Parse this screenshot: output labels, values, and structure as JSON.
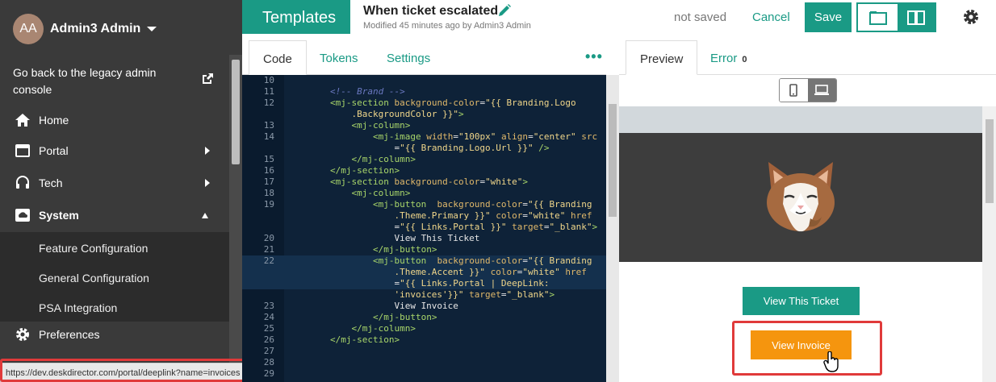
{
  "sidebar": {
    "user": {
      "initials": "AA",
      "name": "Admin3 Admin"
    },
    "legacy_link": "Go back to the legacy admin console",
    "nav": [
      {
        "label": "Home",
        "icon": "home-icon"
      },
      {
        "label": "Portal",
        "icon": "portal-icon"
      },
      {
        "label": "Tech",
        "icon": "headset-icon"
      },
      {
        "label": "System",
        "icon": "cloud-icon"
      },
      {
        "label": "Preferences",
        "icon": "gear-icon"
      }
    ],
    "system_sub": [
      "Feature Configuration",
      "General Configuration",
      "PSA Integration"
    ],
    "status_url": "https://dev.deskdirector.com/portal/deeplink?name=invoices"
  },
  "header": {
    "section": "Templates",
    "title": "When ticket escalated",
    "modified": "Modified 45 minutes ago by Admin3 Admin",
    "status": "not saved",
    "cancel": "Cancel",
    "save": "Save"
  },
  "editor_tabs": [
    "Code",
    "Tokens",
    "Settings"
  ],
  "editor_more": "•••",
  "code_lines": [
    {
      "n": "10",
      "html": ""
    },
    {
      "n": "11",
      "html": "        <span class=\"cmt\">&lt;!-- Brand --&gt;</span>"
    },
    {
      "n": "12",
      "html": "        <span class=\"tag\">&lt;mj-section</span> <span class=\"att\">background-color</span>=<span class=\"str\">\"{{ Branding.Logo</span>"
    },
    {
      "n": "",
      "html": "            <span class=\"str\">.BackgroundColor }}\"</span><span class=\"tag\">&gt;</span>"
    },
    {
      "n": "13",
      "html": "            <span class=\"tag\">&lt;mj-column&gt;</span>"
    },
    {
      "n": "14",
      "html": "                <span class=\"tag\">&lt;mj-image</span> <span class=\"att\">width</span>=<span class=\"str\">\"100px\"</span> <span class=\"att\">align</span>=<span class=\"str\">\"center\"</span> <span class=\"att\">src</span>"
    },
    {
      "n": "",
      "html": "                    =<span class=\"str\">\"{{ Branding.Logo.Url }}\"</span> <span class=\"tag\">/&gt;</span>"
    },
    {
      "n": "15",
      "html": "            <span class=\"tag\">&lt;/mj-column&gt;</span>"
    },
    {
      "n": "16",
      "html": "        <span class=\"tag\">&lt;/mj-section&gt;</span>"
    },
    {
      "n": "17",
      "html": "        <span class=\"tag\">&lt;mj-section</span> <span class=\"att\">background-color</span>=<span class=\"str\">\"white\"</span><span class=\"tag\">&gt;</span>"
    },
    {
      "n": "18",
      "html": "            <span class=\"tag\">&lt;mj-column&gt;</span>"
    },
    {
      "n": "19",
      "html": "                <span class=\"tag\">&lt;mj-button</span>  <span class=\"att\">background-color</span>=<span class=\"str\">\"{{ Branding</span>"
    },
    {
      "n": "",
      "html": "                    <span class=\"str\">.Theme.Primary }}\"</span> <span class=\"att\">color</span>=<span class=\"str\">\"white\"</span> <span class=\"att\">href</span>"
    },
    {
      "n": "",
      "html": "                    =<span class=\"str\">\"{{ Links.Portal }}\"</span> <span class=\"att\">target</span>=<span class=\"str\">\"_blank\"</span><span class=\"tag\">&gt;</span>"
    },
    {
      "n": "20",
      "html": "                    View This Ticket"
    },
    {
      "n": "21",
      "html": "                <span class=\"tag\">&lt;/mj-button&gt;</span>"
    },
    {
      "n": "22",
      "html": "                <span class=\"tag\">&lt;mj-button</span>  <span class=\"att\">background-color</span>=<span class=\"str\">\"{{ Branding</span>"
    },
    {
      "n": "",
      "html": "                    <span class=\"str\">.Theme.Accent }}\"</span> <span class=\"att\">color</span>=<span class=\"str\">\"white\"</span> <span class=\"att\">href</span>"
    },
    {
      "n": "",
      "html": "                    =<span class=\"str\">\"{{ Links.Portal | DeepLink:</span>"
    },
    {
      "n": "",
      "html": "                    <span class=\"str\">'invoices'}}\"</span> <span class=\"att\">target</span>=<span class=\"str\">\"_blank\"</span><span class=\"tag\">&gt;</span>"
    },
    {
      "n": "23",
      "html": "                    View Invoice"
    },
    {
      "n": "24",
      "html": "                <span class=\"tag\">&lt;/mj-button&gt;</span>"
    },
    {
      "n": "25",
      "html": "            <span class=\"tag\">&lt;/mj-column&gt;</span>"
    },
    {
      "n": "26",
      "html": "        <span class=\"tag\">&lt;/mj-section&gt;</span>"
    },
    {
      "n": "27",
      "html": ""
    },
    {
      "n": "28",
      "html": ""
    },
    {
      "n": "29",
      "html": ""
    }
  ],
  "preview_tabs": {
    "preview": "Preview",
    "error": "Error",
    "error_count": "0"
  },
  "preview": {
    "primary_button": "View This Ticket",
    "accent_button": "View Invoice"
  },
  "colors": {
    "brand": "#1a9a85",
    "accent": "#f5950e",
    "sidebar": "#3a3a3a",
    "editor": "#0e2238"
  }
}
